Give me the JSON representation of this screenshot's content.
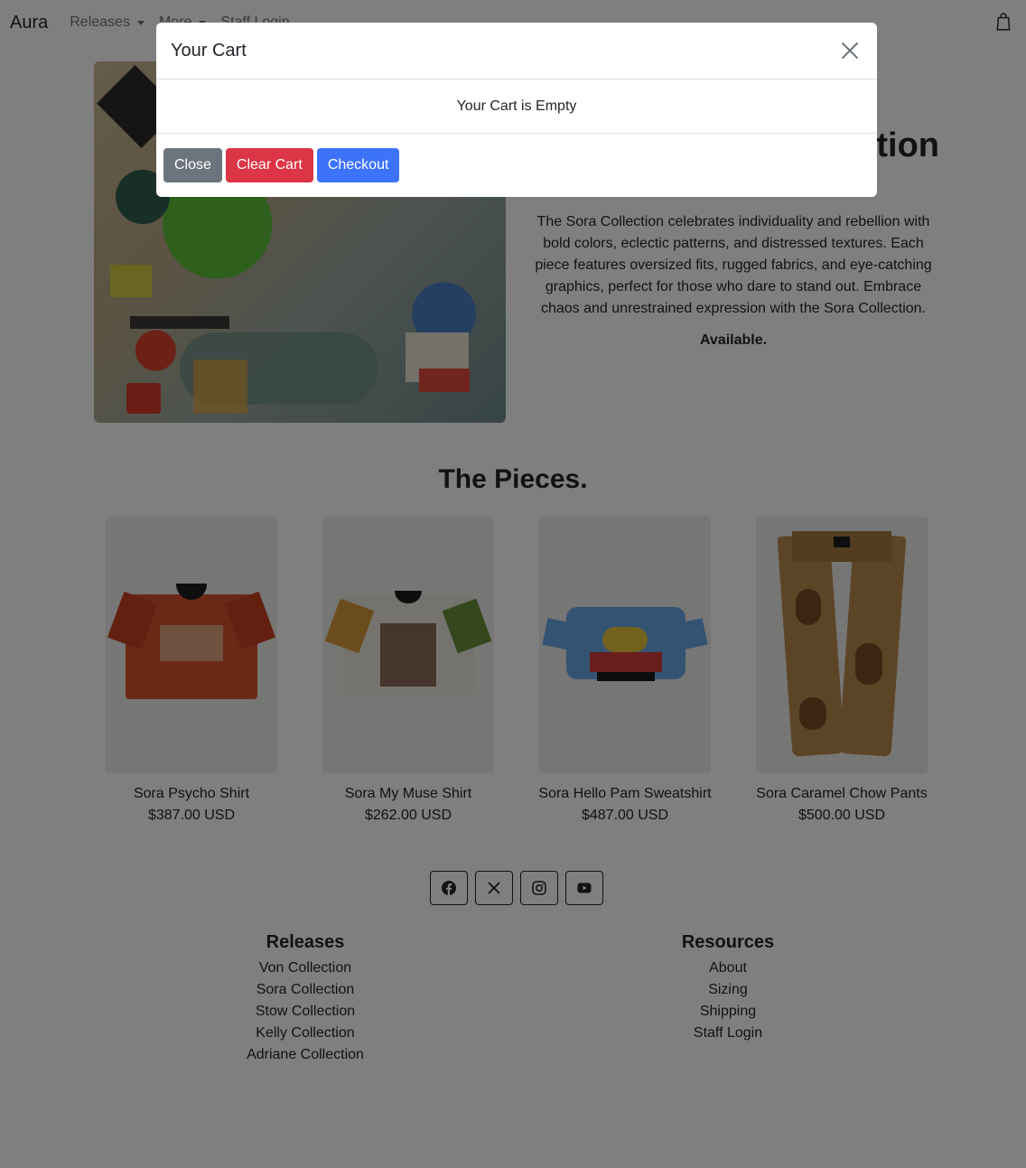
{
  "navbar": {
    "brand": "Aura",
    "links": [
      {
        "label": "Releases",
        "dropdown": true
      },
      {
        "label": "More",
        "dropdown": true
      },
      {
        "label": "Staff Login",
        "dropdown": false
      }
    ],
    "cart_icon": "shopping-bag-icon"
  },
  "hero": {
    "title": "Sora Collection",
    "description": "The Sora Collection celebrates individuality and rebellion with bold colors, eclectic patterns, and distressed textures. Each piece features oversized fits, rugged fabrics, and eye-catching graphics, perfect for those who dare to stand out. Embrace chaos and unrestrained expression with the Sora Collection.",
    "availability": "Available."
  },
  "pieces": {
    "title": "The Pieces.",
    "products": [
      {
        "name": "Sora Psycho Shirt",
        "price": "$387.00 USD"
      },
      {
        "name": "Sora My Muse Shirt",
        "price": "$262.00 USD"
      },
      {
        "name": "Sora Hello Pam Sweatshirt",
        "price": "$487.00 USD"
      },
      {
        "name": "Sora Caramel Chow Pants",
        "price": "$500.00 USD"
      }
    ]
  },
  "social": [
    "facebook-icon",
    "x-icon",
    "instagram-icon",
    "youtube-icon"
  ],
  "footer": {
    "releases": {
      "title": "Releases",
      "links": [
        "Von Collection",
        "Sora Collection",
        "Stow Collection",
        "Kelly Collection",
        "Adriane Collection"
      ]
    },
    "resources": {
      "title": "Resources",
      "links": [
        "About",
        "Sizing",
        "Shipping",
        "Staff Login"
      ]
    }
  },
  "modal": {
    "title": "Your Cart",
    "body": "Your Cart is Empty",
    "buttons": {
      "close": "Close",
      "clear": "Clear Cart",
      "checkout": "Checkout"
    }
  },
  "colors": {
    "danger": "#dc3545",
    "primary": "#3d73fb",
    "secondary": "#6c757d",
    "backdrop": "rgba(0,0,0,0.5)"
  }
}
